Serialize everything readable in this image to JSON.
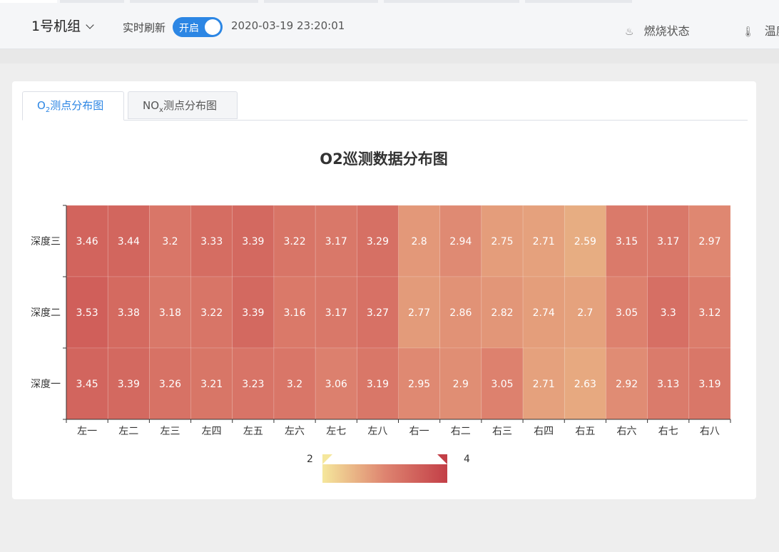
{
  "header": {
    "unit_selector": "1号机组",
    "refresh_label": "实时刷新",
    "toggle_label": "开启",
    "datetime": "2020-03-19 23:20:01",
    "status_items": [
      "燃烧状态",
      "温度"
    ]
  },
  "tabs": [
    {
      "main": "O",
      "sub": "2",
      "rest": "测点分布图"
    },
    {
      "main": "NO",
      "sub": "x",
      "rest": "测点分布图"
    }
  ],
  "colors": {
    "accent": "#2c86e4",
    "scale_low": "#f5e79c",
    "scale_mid": "#de8470",
    "scale_high": "#c33f47"
  },
  "chart_data": {
    "type": "heatmap",
    "title": "O2巡测数据分布图",
    "x_categories": [
      "左一",
      "左二",
      "左三",
      "左四",
      "左五",
      "左六",
      "左七",
      "左八",
      "右一",
      "右二",
      "右三",
      "右四",
      "右五",
      "右六",
      "右七",
      "右八"
    ],
    "y_categories": [
      "深度三",
      "深度二",
      "深度一"
    ],
    "values": [
      [
        3.46,
        3.44,
        3.2,
        3.33,
        3.39,
        3.22,
        3.17,
        3.29,
        2.8,
        2.94,
        2.75,
        2.71,
        2.59,
        3.15,
        3.17,
        2.97
      ],
      [
        3.53,
        3.38,
        3.18,
        3.22,
        3.39,
        3.16,
        3.17,
        3.27,
        2.77,
        2.86,
        2.82,
        2.74,
        2.7,
        3.05,
        3.3,
        3.12
      ],
      [
        3.45,
        3.39,
        3.26,
        3.21,
        3.23,
        3.2,
        3.06,
        3.19,
        2.95,
        2.9,
        3.05,
        2.71,
        2.63,
        2.92,
        3.13,
        3.19
      ]
    ],
    "visual_map": {
      "min": 2,
      "max": 4
    },
    "grid": false,
    "legend_position": "bottom-center"
  }
}
